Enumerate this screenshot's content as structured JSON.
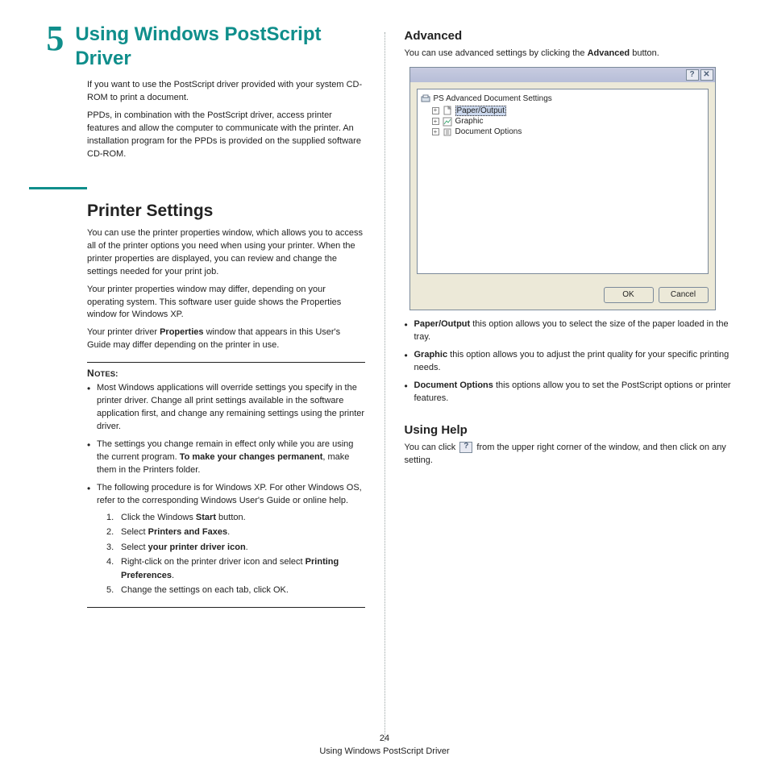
{
  "chapter": {
    "num": "5",
    "title": "Using Windows PostScript Driver"
  },
  "left": {
    "intro1": "If you want to use the PostScript driver provided with your system CD-ROM to print a document.",
    "intro2": "PPDs, in combination with the PostScript driver, access printer features and allow the computer to communicate with the printer. An installation program for the PPDs is provided on the supplied software CD-ROM.",
    "section_heading": "Printer Settings",
    "para1": "You can use the printer properties window, which allows you to access all of the printer options you need when using your printer. When the printer properties are displayed, you can review and change the settings needed for your print job.",
    "para2": "Your printer properties window may differ, depending on your operating system. This software user guide shows the Properties window for Windows XP.",
    "para3_a": "Your printer driver ",
    "para3_b": "Properties",
    "para3_c": " window that appears in this User's Guide may differ depending on the printer in use.",
    "notes_label": "Notes",
    "note1": "Most Windows applications will override settings you specify in the printer driver. Change all print settings available in the software application first, and change any remaining settings using the printer driver.",
    "note2_a": "The settings you change remain in effect only while you are using the current program. ",
    "note2_b": "To make your changes permanent",
    "note2_c": ", make them in the Printers folder.",
    "note3": "The following procedure is for Windows XP. For other Windows OS, refer to the corresponding Windows User's Guide or online help.",
    "steps": {
      "s1_a": "Click the Windows ",
      "s1_b": "Start",
      "s1_c": " button.",
      "s2_a": "Select ",
      "s2_b": "Printers and Faxes",
      "s2_c": ".",
      "s3_a": "Select ",
      "s3_b": "your printer driver icon",
      "s3_c": ".",
      "s4_a": "Right-click on the printer driver icon and select ",
      "s4_b": "Printing Preferences",
      "s4_c": ".",
      "s5": "Change the settings on each tab, click OK."
    }
  },
  "right": {
    "heading_adv": "Advanced",
    "adv_intro_a": "You can use advanced settings by clicking the ",
    "adv_intro_b": "Advanced",
    "adv_intro_c": " button.",
    "dialog": {
      "help_btn": "?",
      "close_btn": "✕",
      "root": "PS Advanced Document Settings",
      "item1": "Paper/Output",
      "item2": "Graphic",
      "item3": "Document Options",
      "ok": "OK",
      "cancel": "Cancel"
    },
    "bul1_a": "Paper/Output",
    "bul1_b": " this option allows you to select the size of the paper loaded in the tray.",
    "bul2_a": "Graphic",
    "bul2_b": " this option allows you to adjust the print quality for your specific printing needs.",
    "bul3_a": "Document Options",
    "bul3_b": " this options allow you to set the PostScript options or printer features.",
    "heading_help": "Using Help",
    "help_a": "You can click ",
    "help_b": " from the upper right corner of the window, and then click on any setting."
  },
  "footer": {
    "page_num": "24",
    "running": "Using Windows PostScript Driver"
  }
}
